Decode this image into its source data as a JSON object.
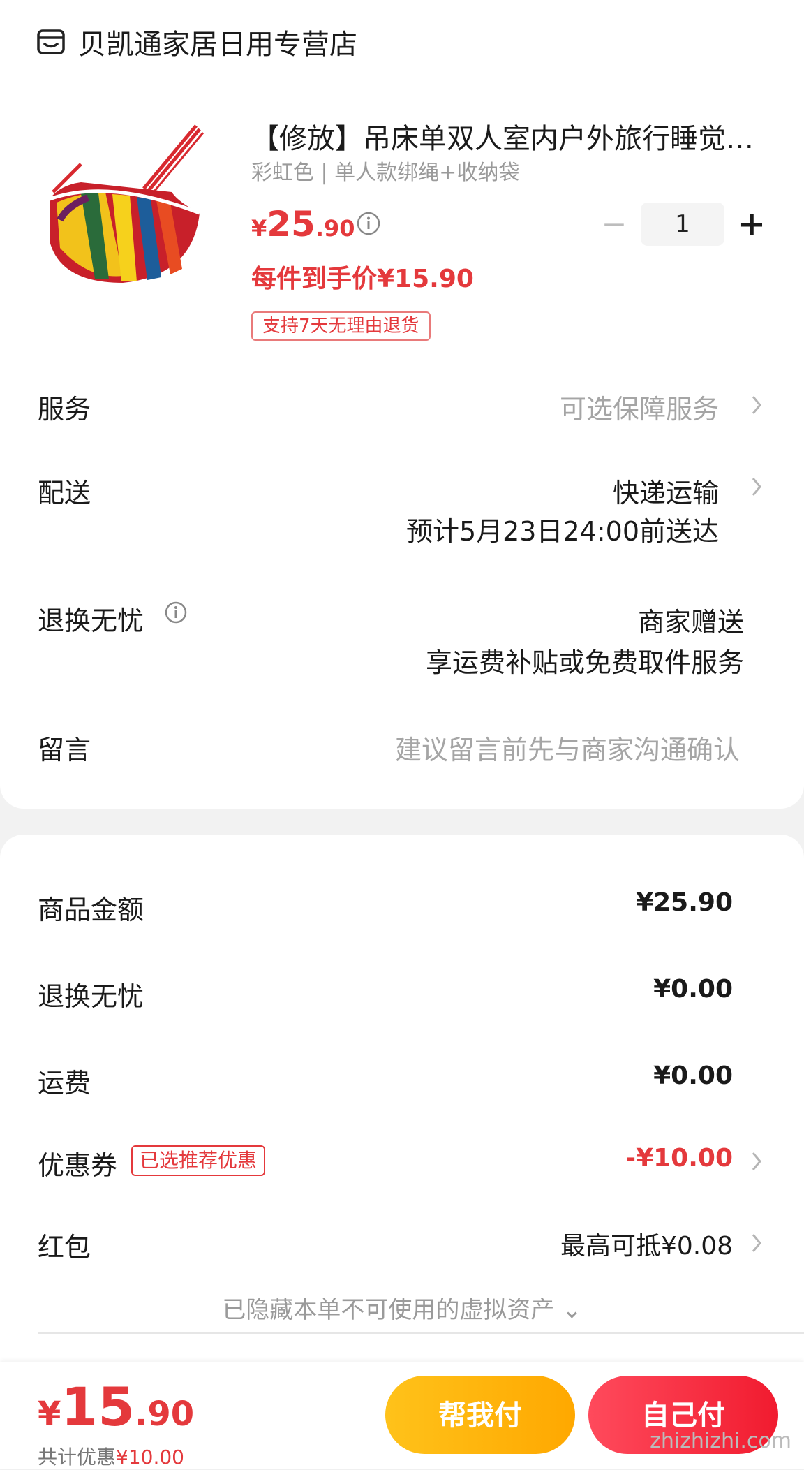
{
  "store": {
    "name": "贝凯通家居日用专营店",
    "icon": "store-icon"
  },
  "product": {
    "title": "【修放】吊床单双人室内户外旅行睡觉…",
    "spec": "彩虹色 | 单人款绑绳+收纳袋",
    "price_currency": "¥",
    "price_int": "25",
    "price_dec": ".90",
    "per_unit_price": "每件到手价¥15.90",
    "return_tag": "支持7天无理由退货",
    "quantity": "1",
    "minus_label": "−",
    "plus_label": "+"
  },
  "rows": {
    "service": {
      "label": "服务",
      "value": "可选保障服务"
    },
    "delivery": {
      "label": "配送",
      "value": "快递运输",
      "eta": "预计5月23日24:00前送达"
    },
    "return": {
      "label": "退换无忧",
      "value": "商家赠送",
      "detail": "享运费补贴或免费取件服务"
    },
    "message": {
      "label": "留言",
      "placeholder": "建议留言前先与商家沟通确认"
    }
  },
  "summary": {
    "goods": {
      "label": "商品金额",
      "value": "¥25.90"
    },
    "return": {
      "label": "退换无忧",
      "value": "¥0.00"
    },
    "shipping": {
      "label": "运费",
      "value": "¥0.00"
    },
    "coupon": {
      "label": "优惠券",
      "tag": "已选推荐优惠",
      "value": "-¥10.00"
    },
    "redpacket": {
      "label": "红包",
      "value": "最高可抵¥0.08"
    },
    "hidden_assets": "已隐藏本单不可使用的虚拟资产 ⌄"
  },
  "footer": {
    "currency": "¥",
    "total_int": "15",
    "total_dec": ".90",
    "discount_prefix": "共计优惠",
    "discount_value": "¥10.00",
    "help_pay_label": "帮我付",
    "self_pay_label": "自己付"
  },
  "watermark": "zhizhizhi.com",
  "colors": {
    "accent_red": "#e4393c",
    "help_yellow": "#ffb300",
    "pay_red": "#f11b2f"
  }
}
